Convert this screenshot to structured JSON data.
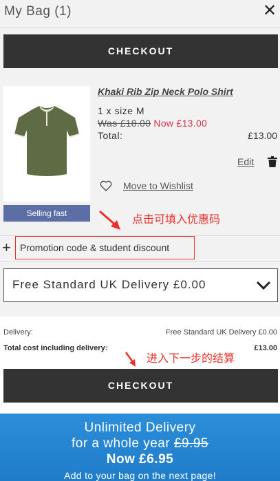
{
  "header": {
    "title": "My Bag (1)",
    "close_glyph": "✕",
    "close_icon": "close-icon"
  },
  "checkout": {
    "label": "CHECKOUT"
  },
  "product": {
    "name": "Khaki Rib Zip Neck Polo Shirt",
    "size": "1 x size M",
    "was_price": "Was £18.00",
    "now_price": "Now £13.00",
    "total_label": "Total:",
    "total_value": "£13.00",
    "badge": "Selling fast",
    "edit_label": "Edit",
    "wishlist_label": "Move to Wishlist",
    "shirt_color": "#5e6b45"
  },
  "annotations": {
    "promo_hint": "点击可填入优惠码",
    "checkout_hint": "进入下一步的结算",
    "color": "#e8312a"
  },
  "promo": {
    "plus_glyph": "+",
    "label": "Promotion code & student discount"
  },
  "delivery_select": {
    "selected": "Free Standard UK Delivery £0.00"
  },
  "summary": {
    "delivery_label": "Delivery:",
    "delivery_value": "Free Standard UK Delivery £0.00",
    "total_label": "Total cost including delivery:",
    "total_value": "£13.00"
  },
  "banner": {
    "line1": "Unlimited Delivery",
    "line2_prefix": "for a whole year",
    "line2_old_price": "£9.95",
    "line3": "Now £6.95",
    "line4": "Add to your bag on the next page!",
    "color": "#2d8ed9"
  }
}
